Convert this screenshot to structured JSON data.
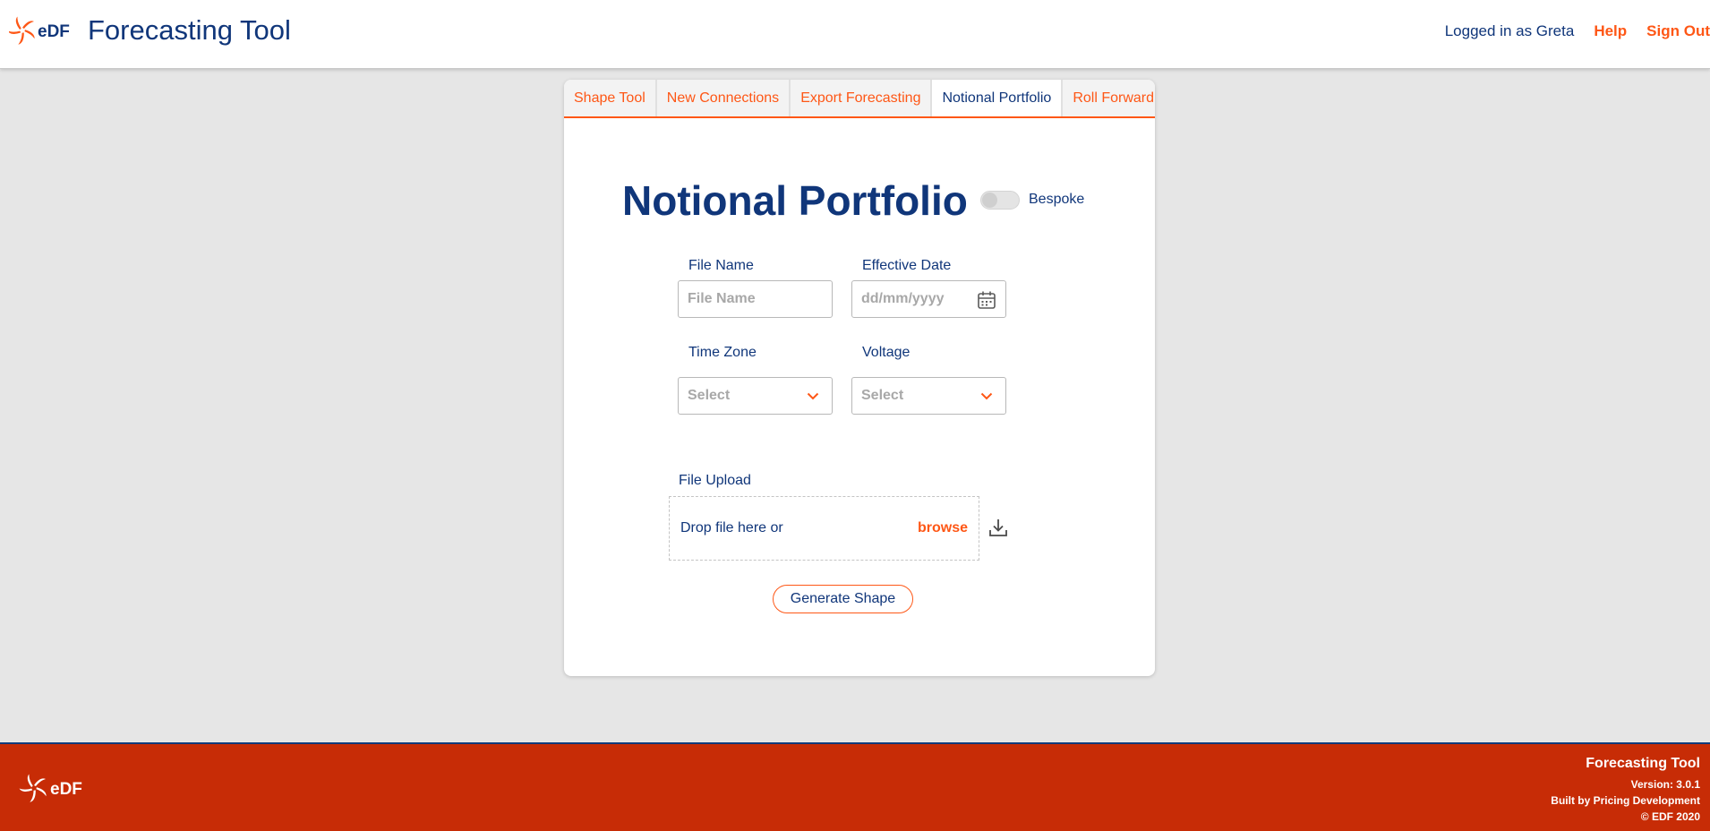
{
  "header": {
    "logo_text": "eDF",
    "title": "Forecasting Tool",
    "logged_in": "Logged in as Greta",
    "help": "Help",
    "sign_out": "Sign Out"
  },
  "tabs": [
    {
      "label": "Shape Tool",
      "active": false
    },
    {
      "label": "New Connections",
      "active": false
    },
    {
      "label": "Export Forecasting",
      "active": false
    },
    {
      "label": "Notional Portfolio",
      "active": true
    },
    {
      "label": "Roll Forward",
      "active": false
    }
  ],
  "form": {
    "title": "Notional Portfolio",
    "toggle_label": "Bespoke",
    "toggle_on": false,
    "file_name": {
      "label": "File Name",
      "placeholder": "File Name",
      "value": ""
    },
    "effective_date": {
      "label": "Effective Date",
      "placeholder": "dd/mm/yyyy"
    },
    "time_zone": {
      "label": "Time Zone",
      "value": "Select"
    },
    "voltage": {
      "label": "Voltage",
      "value": "Select"
    },
    "upload": {
      "label": "File Upload",
      "drop_text": "Drop file here or",
      "browse": "browse"
    },
    "generate_label": "Generate Shape"
  },
  "footer": {
    "logo_text": "eDF",
    "title": "Forecasting Tool",
    "version": "Version: 3.0.1",
    "built_by": "Built by Pricing Development",
    "copyright": "© EDF 2020"
  },
  "colors": {
    "brand_orange": "#fe5716",
    "brand_navy": "#10367a",
    "footer_red": "#c72c06",
    "page_bg": "#e6e6e6"
  },
  "icons": [
    "edf-logo-icon",
    "calendar-icon",
    "chevron-down-icon",
    "download-icon"
  ]
}
